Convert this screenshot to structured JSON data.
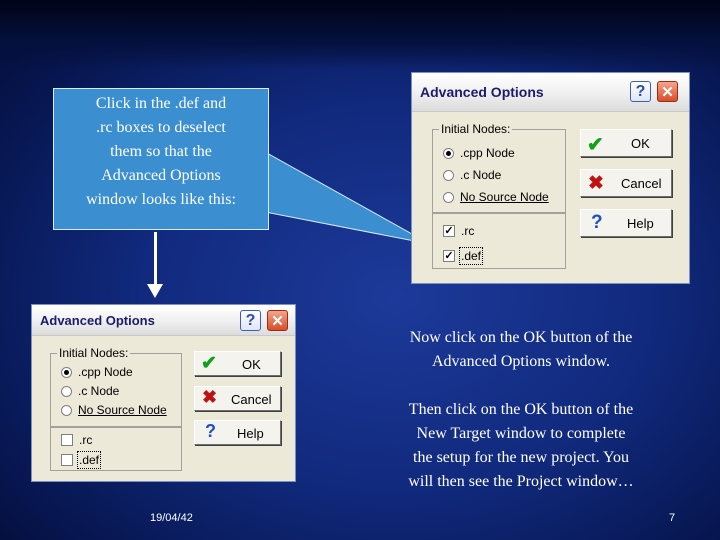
{
  "callout": {
    "lines": [
      "Click in the .def  and",
      ".rc boxes to deselect",
      "them so that the",
      "Advanced Options",
      "window looks like this:"
    ]
  },
  "dialog_before": {
    "title": "Advanced Options",
    "help_symbol": "?",
    "close_symbol": "✕",
    "group_label": "Initial Nodes:",
    "radios": [
      ".cpp Node",
      ".c Node",
      "No Source Node"
    ],
    "selected_radio": ".cpp Node",
    "checkboxes": [
      {
        "label": ".rc",
        "checked": true
      },
      {
        "label": ".def",
        "checked": true
      }
    ],
    "buttons": {
      "ok": "OK",
      "cancel": "Cancel",
      "help": "Help"
    },
    "icons": {
      "ok": "✔",
      "cancel": "✖",
      "help": "?"
    }
  },
  "dialog_after": {
    "title": "Advanced Options",
    "help_symbol": "?",
    "close_symbol": "✕",
    "group_label": "Initial Nodes:",
    "radios": [
      ".cpp Node",
      ".c Node",
      "No Source Node"
    ],
    "selected_radio": ".cpp Node",
    "checkboxes": [
      {
        "label": ".rc",
        "checked": false
      },
      {
        "label": ".def",
        "checked": false
      }
    ],
    "buttons": {
      "ok": "OK",
      "cancel": "Cancel",
      "help": "Help"
    },
    "icons": {
      "ok": "✔",
      "cancel": "✖",
      "help": "?"
    }
  },
  "instructions": {
    "first": [
      "Now click on the OK button of the",
      "Advanced Options window."
    ],
    "second": [
      "Then click on the OK button of the",
      "New Target window to complete",
      "the setup for the new project.  You",
      "will then see the Project window…"
    ]
  },
  "footer": {
    "date": "19/04/42",
    "page": "7"
  },
  "colors": {
    "background": "#112a7e",
    "callout": "#3b8fd0",
    "text": "#ffffff"
  }
}
